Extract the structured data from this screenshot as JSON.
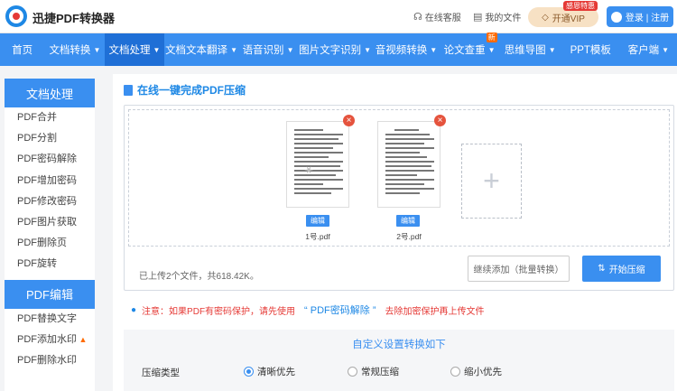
{
  "header": {
    "brand": "迅捷PDF转换器",
    "service_label": "在线客服",
    "files_label": "我的文件",
    "vip_label": "开通VIP",
    "vip_badge": "感恩特惠",
    "login_label": "登录 | 注册"
  },
  "nav": {
    "items": [
      {
        "label": "首页",
        "caret": false
      },
      {
        "label": "文档转换",
        "caret": true
      },
      {
        "label": "文档处理",
        "caret": true,
        "active": true
      },
      {
        "label": "文档文本翻译",
        "caret": true
      },
      {
        "label": "语音识别",
        "caret": true
      },
      {
        "label": "图片文字识别",
        "caret": true
      },
      {
        "label": "音视频转换",
        "caret": true
      },
      {
        "label": "论文查重",
        "caret": true,
        "badge": "新"
      },
      {
        "label": "思维导图",
        "caret": true
      },
      {
        "label": "PPT模板",
        "caret": false
      },
      {
        "label": "客户端",
        "caret": true
      }
    ]
  },
  "sidebar": {
    "section1_title": "文档处理",
    "section1_items": [
      "PDF合并",
      "PDF分割",
      "PDF密码解除",
      "PDF增加密码",
      "PDF修改密码",
      "PDF图片获取",
      "PDF删除页",
      "PDF旋转"
    ],
    "section2_title": "PDF编辑",
    "section2_items": [
      "PDF替换文字",
      "PDF添加水印",
      "PDF删除水印"
    ]
  },
  "main": {
    "title": "在线一键完成PDF压缩",
    "files": [
      {
        "name": "1号.pdf",
        "edit_label": "编辑"
      },
      {
        "name": "2号.pdf",
        "edit_label": "编辑"
      }
    ],
    "upload_status": "已上传2个文件，共618.42K。",
    "continue_label": "继续添加（批量转换）",
    "start_label": "开始压缩",
    "notice_prefix": "注意：如果PDF有密码保护，请先使用",
    "notice_link": "“ PDF密码解除 ”",
    "notice_suffix": "去除加密保护再上传文件",
    "settings_title": "自定义设置转换如下",
    "compress_label": "压缩类型",
    "options": [
      {
        "label": "清晰优先",
        "checked": true
      },
      {
        "label": "常规压缩",
        "checked": false
      },
      {
        "label": "缩小优先",
        "checked": false
      }
    ]
  },
  "colors": {
    "accent": "#3a8ff0",
    "nav_active": "#1f6fd6",
    "warning": "#e53935"
  }
}
